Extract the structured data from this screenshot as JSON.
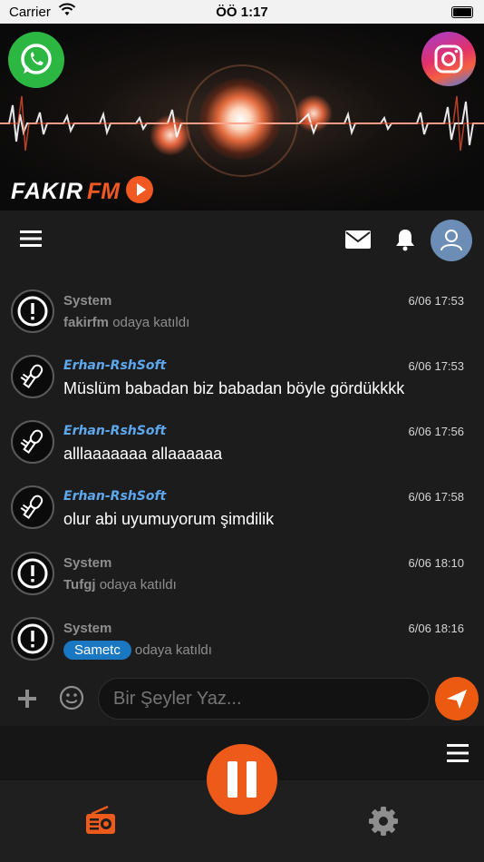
{
  "status_bar": {
    "carrier": "Carrier",
    "time": "ÖÖ 1:17"
  },
  "banner": {
    "logo_part1": "FAKIR",
    "logo_part2": "FM"
  },
  "messages": [
    {
      "type": "system",
      "name": "System",
      "time": "6/06 17:53",
      "user": "fakirfm",
      "text": "odaya katıldı"
    },
    {
      "type": "user",
      "name": "Erhan-RshSoft",
      "time": "6/06 17:53",
      "text": "Müslüm babadan biz babadan böyle gördükkkk"
    },
    {
      "type": "user",
      "name": "Erhan-RshSoft",
      "time": "6/06 17:56",
      "text": "alllaaaaaaa allaaaaaa"
    },
    {
      "type": "user",
      "name": "Erhan-RshSoft",
      "time": "6/06 17:58",
      "text": "olur abi uyumuyorum şimdilik"
    },
    {
      "type": "system",
      "name": "System",
      "time": "6/06 18:10",
      "user": "Tufgj",
      "text": "odaya katıldı"
    },
    {
      "type": "system",
      "name": "System",
      "time": "6/06 18:16",
      "user": "Sametc",
      "text": "odaya katıldı"
    }
  ],
  "input": {
    "placeholder": "Bir Şeyler Yaz..."
  },
  "icons": {
    "whatsapp": "whatsapp-icon",
    "instagram": "instagram-icon",
    "play": "play-icon",
    "menu": "hamburger-icon",
    "mail": "mail-icon",
    "bell": "bell-icon",
    "avatar": "user-icon",
    "system": "exclamation-icon",
    "user_avatar": "microphone-icon",
    "plus": "plus-icon",
    "emoji": "smiley-icon",
    "send": "send-icon",
    "pause": "pause-icon",
    "list": "list-icon",
    "radio": "radio-icon",
    "settings": "gear-icon"
  },
  "colors": {
    "accent": "#ec5a12",
    "username": "#5da8ee",
    "tag": "#1a78c2",
    "background": "#1c1c1d",
    "system_text": "#8e8e8e",
    "whatsapp": "#2bb741"
  }
}
